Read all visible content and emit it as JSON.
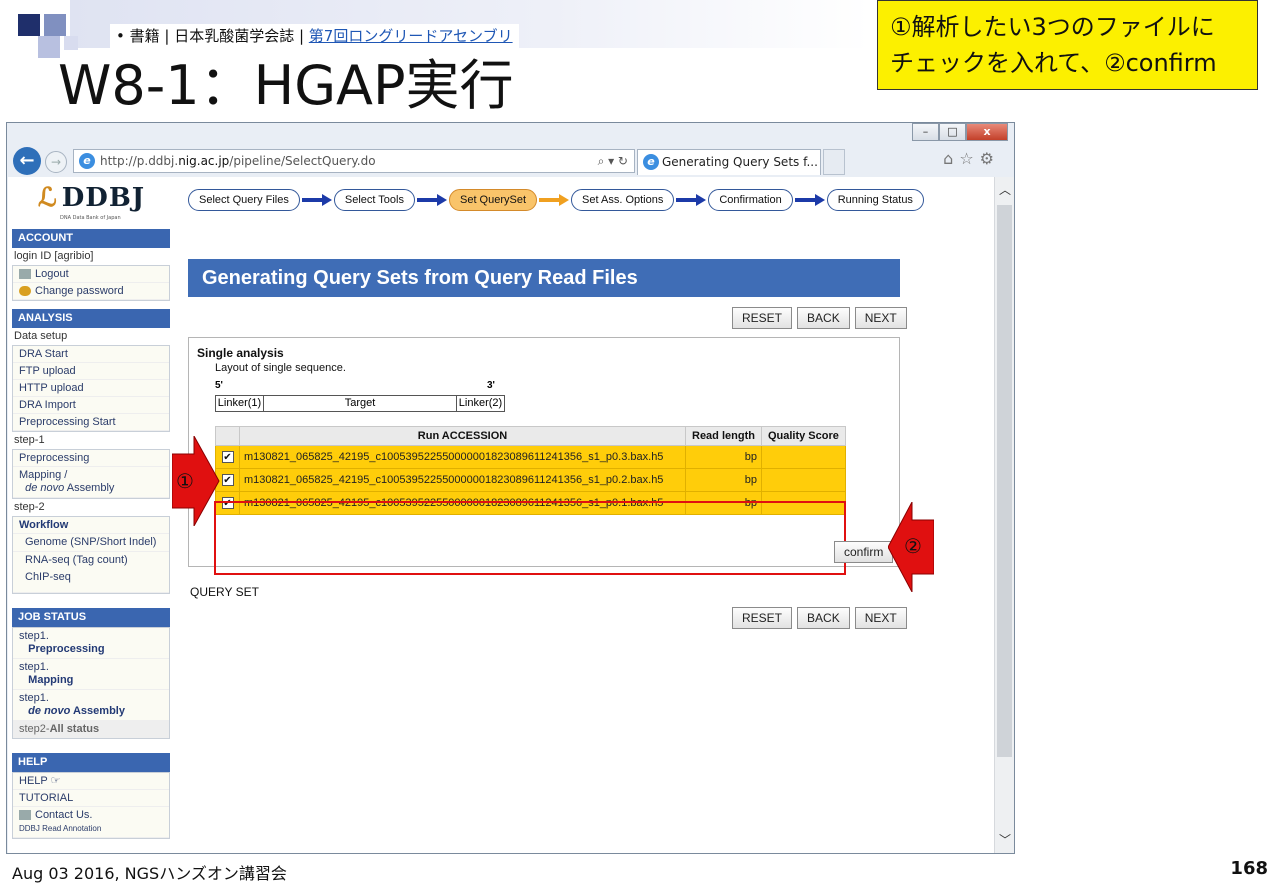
{
  "slide": {
    "subtitle_prefix": "• 書籍 | 日本乳酸菌学会誌 | ",
    "subtitle_link": "第7回ロングリードアセンブリ",
    "title": "W8-1：HGAP実行",
    "note": "①解析したい3つのファイルに\nチェックを入れて、②confirm",
    "footer": "Aug 03 2016, NGSハンズオン講習会",
    "page_number": "168",
    "marker1": "①",
    "marker2": "②"
  },
  "browser": {
    "url_prefix": "http://p.ddbj.",
    "url_domain": "nig.ac.jp",
    "url_path": "/pipeline/SelectQuery.do",
    "tab_title": "Generating Query Sets f...",
    "tab_close": "×",
    "window_controls": [
      "–",
      "□",
      "x"
    ]
  },
  "logo": {
    "name": "DDBJ",
    "tagline": "DNA Data Bank of Japan"
  },
  "sidebar": {
    "account": {
      "header": "ACCOUNT",
      "login": "login ID [agribio]",
      "items": [
        "Logout",
        "Change password"
      ]
    },
    "analysis": {
      "header": "ANALYSIS",
      "data_setup": "Data setup",
      "setup_items": [
        "DRA Start",
        "FTP upload",
        "HTTP upload",
        "DRA Import",
        "Preprocessing Start"
      ],
      "step1": "step-1",
      "step1_items": [
        "Preprocessing",
        "Mapping /"
      ],
      "step1_sub": "de novo",
      "step1_sub_rest": " Assembly",
      "step2": "step-2",
      "workflow": "Workflow",
      "workflow_items": [
        "Genome (SNP/Short Indel)",
        "RNA-seq (Tag count)",
        "ChIP-seq"
      ]
    },
    "job_status": {
      "header": "JOB STATUS",
      "step_label": "step1.",
      "items": [
        "Preprocessing",
        "Mapping"
      ],
      "denovo_italic": "de novo",
      "denovo_rest": " Assembly",
      "all_prefix": "step2-",
      "all_bold": "All status"
    },
    "help": {
      "header": "HELP",
      "items": [
        "HELP ☞",
        "TUTORIAL",
        "Contact Us."
      ],
      "contact_sub": "DDBJ Read Annotation"
    }
  },
  "steps": [
    {
      "label": "Select Query Files",
      "active": false
    },
    {
      "label": "Select Tools",
      "active": false
    },
    {
      "label": "Set QuerySet",
      "active": true
    },
    {
      "label": "Set Ass. Options",
      "active": false
    },
    {
      "label": "Confirmation",
      "active": false
    },
    {
      "label": "Running Status",
      "active": false
    }
  ],
  "main": {
    "heading": "Generating Query Sets from Query Read Files",
    "buttons": [
      "RESET",
      "BACK",
      "NEXT"
    ],
    "single_analysis": "Single analysis",
    "layout_text": "Layout of single sequence.",
    "five_prime": "5'",
    "three_prime": "3'",
    "linker1": "Linker(1)",
    "target": "Target",
    "linker2": "Linker(2)",
    "table": {
      "headers": [
        "",
        "Run ACCESSION",
        "Read length",
        "Quality Score"
      ],
      "rows": [
        {
          "checked": "✔",
          "accession": "m130821_065825_42195_c100539522550000001823089611241356_s1_p0.3.bax.h5",
          "read_length": "bp",
          "quality": ""
        },
        {
          "checked": "✔",
          "accession": "m130821_065825_42195_c100539522550000001823089611241356_s1_p0.2.bax.h5",
          "read_length": "bp",
          "quality": ""
        },
        {
          "checked": "✔",
          "accession": "m130821_065825_42195_c100539522550000001823089611241356_s1_p0.1.bax.h5",
          "read_length": "bp",
          "quality": ""
        }
      ]
    },
    "confirm": "confirm",
    "query_set": "QUERY SET"
  }
}
